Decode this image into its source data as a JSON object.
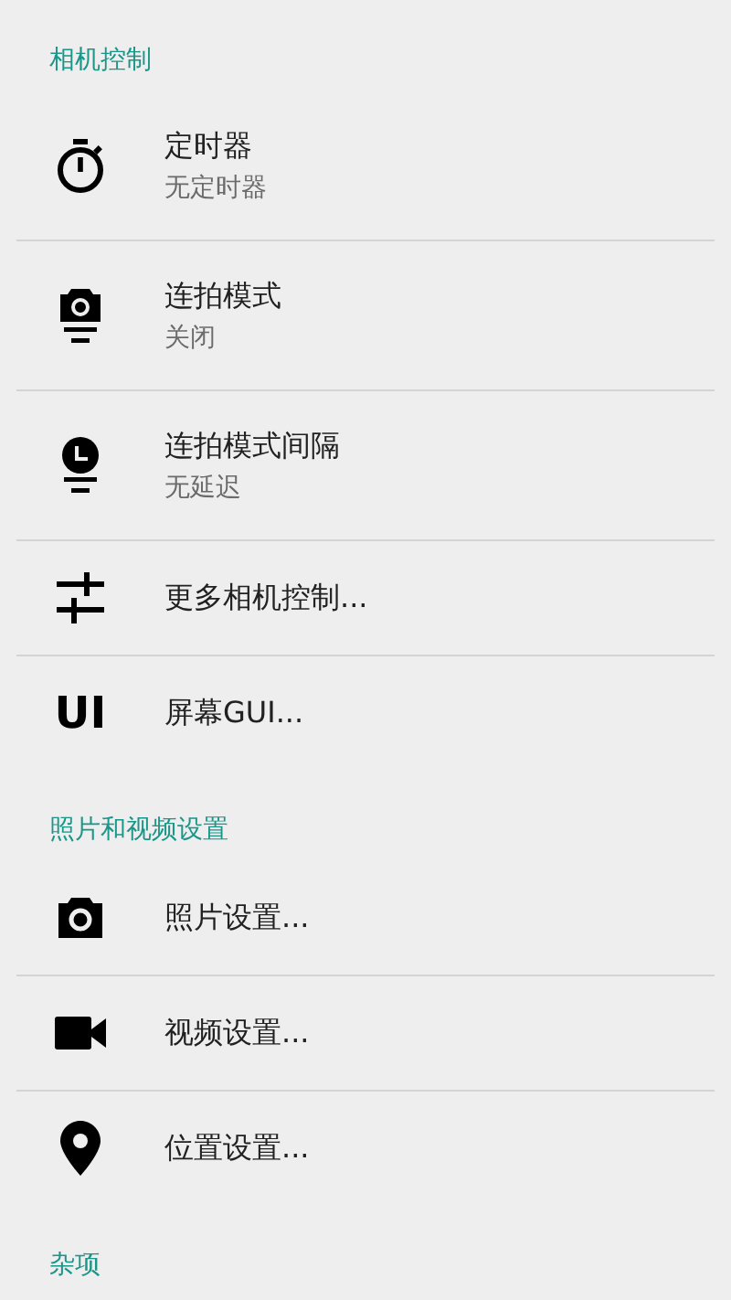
{
  "sections": [
    {
      "title": "相机控制",
      "items": [
        {
          "title": "定时器",
          "summary": "无定时器"
        },
        {
          "title": "连拍模式",
          "summary": "关闭"
        },
        {
          "title": "连拍模式间隔",
          "summary": "无延迟"
        },
        {
          "title": "更多相机控制..."
        },
        {
          "title": "屏幕GUI...",
          "icon_text": "UI"
        }
      ]
    },
    {
      "title": "照片和视频设置",
      "items": [
        {
          "title": "照片设置..."
        },
        {
          "title": "视频设置..."
        },
        {
          "title": "位置设置..."
        }
      ]
    },
    {
      "title": "杂项"
    }
  ]
}
